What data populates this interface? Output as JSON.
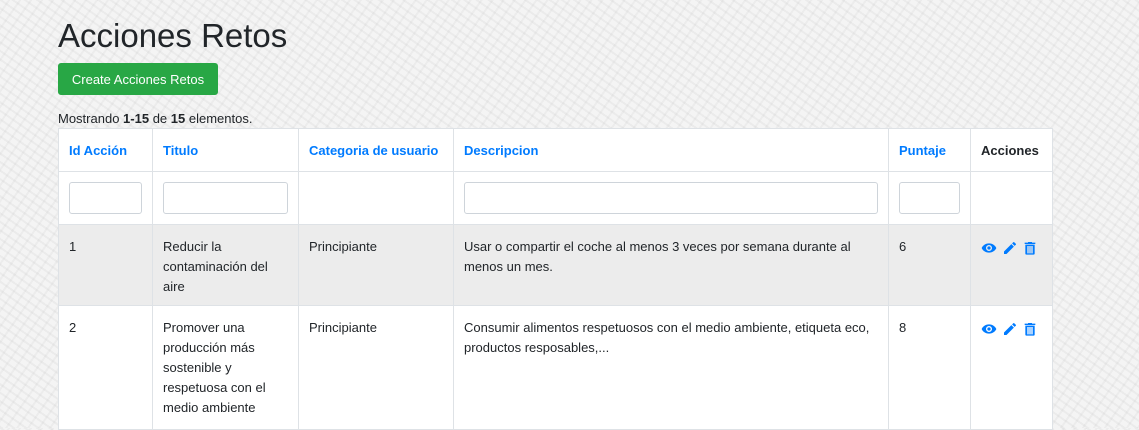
{
  "page": {
    "title": "Acciones Retos"
  },
  "toolbar": {
    "create_label": "Create Acciones Retos"
  },
  "summary": {
    "prefix": "Mostrando ",
    "range": "1-15",
    "middle": " de ",
    "total": "15",
    "suffix": " elementos."
  },
  "table": {
    "headers": {
      "id": "Id Acción",
      "titulo": "Titulo",
      "categoria": "Categoria de usuario",
      "descripcion": "Descripcion",
      "puntaje": "Puntaje",
      "acciones": "Acciones"
    },
    "rows": [
      {
        "id": "1",
        "titulo": "Reducir la contaminación del aire",
        "categoria": "Principiante",
        "descripcion": "Usar o compartir el coche al menos 3 veces por semana durante al menos un mes.",
        "puntaje": "6"
      },
      {
        "id": "2",
        "titulo": "Promover una producción más sostenible y respetuosa con el medio ambiente",
        "categoria": "Principiante",
        "descripcion": "Consumir alimentos respetuosos con el medio ambiente, etiqueta eco, productos resposables,...",
        "puntaje": "8"
      }
    ],
    "row_actions": [
      "eye-icon",
      "pencil-icon",
      "trash-icon"
    ]
  },
  "colors": {
    "accent": "#007bff",
    "success": "#28a745",
    "striped_row": "#ececec"
  }
}
